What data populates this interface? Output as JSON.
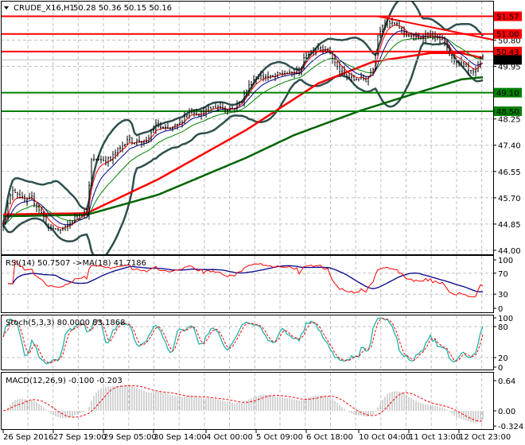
{
  "header": {
    "symbol": "CRUDE_X16,H1",
    "ohlc": "50.28 50.36 50.15 50.16"
  },
  "indicators": {
    "rsi_label": "RSI(14) 50.7507  ->MA(18) 41.7186",
    "stoch_label": "Stoch(5,3,3) 80.0000 83.1868",
    "macd_label": "MACD(12,26,9) -0.100 -0.203"
  },
  "colors": {
    "resistance": "#ff0000",
    "support": "#008000",
    "current": "#000000",
    "bars": "#000000",
    "bollinger": "#2f4f4f",
    "ema_fast": "#ff0000",
    "ema_mid": "#00008b",
    "ema_slow": "#008000",
    "rsi": "#ff0000",
    "rsi_ma": "#00008b",
    "stoch_k": "#20b2aa",
    "stoch_d": "#ff0000",
    "macd_hist": "#a9a9a9",
    "macd_signal": "#ff0000"
  },
  "chart_data": {
    "type": "ohlc",
    "title": "CRUDE_X16,H1",
    "last_bar": {
      "open": 50.28,
      "high": 50.36,
      "low": 50.15,
      "close": 50.16
    },
    "bar_count": 202,
    "close_keypoints": [
      [
        0,
        44.9
      ],
      [
        4,
        45.85
      ],
      [
        9,
        45.67
      ],
      [
        12,
        45.8
      ],
      [
        15,
        45.3
      ],
      [
        19,
        44.6
      ],
      [
        24,
        44.77
      ],
      [
        30,
        45.0
      ],
      [
        35,
        45.15
      ],
      [
        37,
        46.95
      ],
      [
        40,
        47.1
      ],
      [
        45,
        46.85
      ],
      [
        49,
        47.2
      ],
      [
        52,
        47.7
      ],
      [
        57,
        47.6
      ],
      [
        60,
        47.35
      ],
      [
        64,
        48.0
      ],
      [
        69,
        48.05
      ],
      [
        74,
        48.0
      ],
      [
        79,
        48.5
      ],
      [
        85,
        48.6
      ],
      [
        92,
        48.5
      ],
      [
        97,
        48.75
      ],
      [
        100,
        48.94
      ],
      [
        105,
        49.4
      ],
      [
        110,
        49.73
      ],
      [
        115,
        49.7
      ],
      [
        120,
        49.58
      ],
      [
        124,
        49.84
      ],
      [
        127,
        50.5
      ],
      [
        132,
        50.48
      ],
      [
        137,
        50.38
      ],
      [
        140,
        50.04
      ],
      [
        144,
        49.66
      ],
      [
        147,
        49.4
      ],
      [
        152,
        49.53
      ],
      [
        155,
        50.04
      ],
      [
        157,
        51.07
      ],
      [
        159,
        51.33
      ],
      [
        162,
        51.2
      ],
      [
        167,
        51.2
      ],
      [
        170,
        51.07
      ],
      [
        174,
        50.8
      ],
      [
        179,
        50.86
      ],
      [
        184,
        50.94
      ],
      [
        185,
        50.8
      ],
      [
        188,
        50.17
      ],
      [
        192,
        49.9
      ],
      [
        195,
        49.78
      ],
      [
        198,
        49.84
      ],
      [
        200,
        50.3
      ],
      [
        201,
        50.16
      ]
    ],
    "ma_slow_red_keypoints": [
      [
        0,
        45.16
      ],
      [
        35,
        45.2
      ],
      [
        65,
        46.3
      ],
      [
        102,
        47.9
      ],
      [
        132,
        49.4
      ],
      [
        155,
        50.1
      ],
      [
        179,
        50.38
      ],
      [
        192,
        50.38
      ],
      [
        201,
        50.22
      ]
    ],
    "ma_slow_green_keypoints": [
      [
        0,
        45.1
      ],
      [
        35,
        45.15
      ],
      [
        65,
        45.8
      ],
      [
        102,
        47.0
      ],
      [
        122,
        47.73
      ],
      [
        149,
        48.5
      ],
      [
        172,
        49.06
      ],
      [
        192,
        49.53
      ],
      [
        201,
        49.6
      ]
    ],
    "horizontal_levels": [
      {
        "price": 51.57,
        "label": "51.57",
        "kind": "resistance"
      },
      {
        "price": 51.0,
        "label": "51.00",
        "kind": "resistance"
      },
      {
        "price": 50.43,
        "label": "50.43",
        "kind": "resistance"
      },
      {
        "price": 49.1,
        "label": "49.10",
        "kind": "support"
      },
      {
        "price": 48.5,
        "label": "48.50",
        "kind": "support"
      }
    ],
    "current_price": {
      "price": 50.16,
      "label": "50.16"
    },
    "trendline": {
      "from": [
        157,
        51.57
      ],
      "to": [
        206,
        50.8
      ]
    },
    "y_ticks": [
      "50.80",
      "49.95",
      "48.25",
      "47.40",
      "46.55",
      "45.70",
      "44.85",
      "44.00"
    ],
    "ylim": [
      44.0,
      51.65
    ],
    "x_ticks": [
      {
        "bar": 0,
        "label": "26 Sep 2016"
      },
      {
        "bar": 21,
        "label": "27 Sep 19:00"
      },
      {
        "bar": 42,
        "label": "29 Sep 05:00"
      },
      {
        "bar": 63,
        "label": "30 Sep 14:00"
      },
      {
        "bar": 85,
        "label": "4 Oct 00:00"
      },
      {
        "bar": 106,
        "label": "5 Oct 09:00"
      },
      {
        "bar": 127,
        "label": "6 Oct 18:00"
      },
      {
        "bar": 149,
        "label": "10 Oct 04:00"
      },
      {
        "bar": 170,
        "label": "11 Oct 13:00"
      },
      {
        "bar": 191,
        "label": "12 Oct 23:00"
      }
    ],
    "rsi_ticks": [
      "100",
      "70",
      "30",
      "0"
    ],
    "stoch_ticks": [
      "100",
      "80",
      "20",
      "0"
    ],
    "macd_ticks": [
      "0.64",
      "0.00",
      "-0.324"
    ]
  }
}
